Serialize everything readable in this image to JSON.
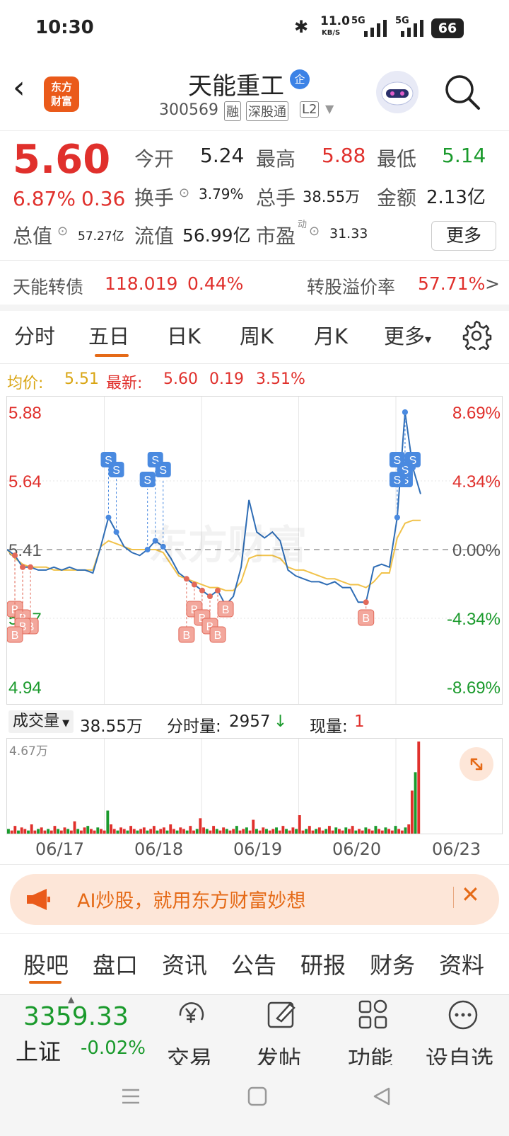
{
  "status": {
    "time": "10:30",
    "speed": "11.0",
    "speed_unit": "KB/S",
    "battery": "66",
    "net1": "5G",
    "net2": "5G"
  },
  "header": {
    "title": "天能重工",
    "code": "300569",
    "tags": [
      "融",
      "深股通",
      "L2"
    ],
    "logo": "东方\n财富",
    "title_badge": "企"
  },
  "quote": {
    "price": "5.60",
    "change_pct": "6.87%",
    "change": "0.36",
    "open_label": "今开",
    "open": "5.24",
    "high_label": "最高",
    "high": "5.88",
    "low_label": "最低",
    "low": "5.14",
    "turnover_label": "换手",
    "turnover": "3.79%",
    "volume_label": "总手",
    "volume": "38.55万",
    "amount_label": "金额",
    "amount": "2.13亿",
    "mcap_label": "总值",
    "mcap": "57.27亿",
    "float_label": "流值",
    "float": "56.99亿",
    "pe_label": "市盈",
    "pe_sup": "动",
    "pe": "31.33",
    "more": "更多"
  },
  "bond": {
    "name": "天能转债",
    "price": "118.019",
    "pct": "0.44%",
    "premium_label": "转股溢价率",
    "premium": "57.71%",
    "arrow": ">"
  },
  "tabs": {
    "items": [
      "分时",
      "五日",
      "日K",
      "周K",
      "月K",
      "更多"
    ],
    "active": "五日",
    "more_arrow": "▾"
  },
  "info": {
    "avg_label": "均价:",
    "avg": "5.51",
    "latest_label": "最新:",
    "latest": "5.60",
    "chg": "0.19",
    "pct": "3.51%"
  },
  "chart_data": {
    "type": "line",
    "title": "",
    "x": [
      "06/17",
      "06/18",
      "06/19",
      "06/20",
      "06/23"
    ],
    "y_left_ticks": [
      "5.88",
      "5.64",
      "5.41",
      "5.17",
      "4.94"
    ],
    "y_right_ticks": [
      "8.69%",
      "4.34%",
      "0.00%",
      "-4.34%",
      "-8.69%"
    ],
    "ylim": [
      4.94,
      5.88
    ],
    "prev_close": 5.41,
    "price": [
      5.41,
      5.39,
      5.35,
      5.35,
      5.34,
      5.34,
      5.35,
      5.34,
      5.35,
      5.34,
      5.34,
      5.33,
      5.42,
      5.52,
      5.47,
      5.42,
      5.4,
      5.39,
      5.41,
      5.44,
      5.42,
      5.38,
      5.33,
      5.31,
      5.29,
      5.27,
      5.25,
      5.27,
      5.22,
      5.25,
      5.35,
      5.58,
      5.47,
      5.45,
      5.47,
      5.44,
      5.34,
      5.32,
      5.31,
      5.3,
      5.3,
      5.29,
      5.3,
      5.28,
      5.28,
      5.23,
      5.23,
      5.35,
      5.36,
      5.35,
      5.52,
      5.88,
      5.69,
      5.6
    ],
    "avg": [
      5.41,
      5.38,
      5.36,
      5.35,
      5.35,
      5.35,
      5.34,
      5.34,
      5.34,
      5.34,
      5.34,
      5.34,
      5.42,
      5.44,
      5.43,
      5.42,
      5.41,
      5.41,
      5.41,
      5.41,
      5.4,
      5.36,
      5.32,
      5.31,
      5.3,
      5.29,
      5.28,
      5.28,
      5.27,
      5.27,
      5.3,
      5.38,
      5.39,
      5.39,
      5.39,
      5.38,
      5.35,
      5.34,
      5.34,
      5.33,
      5.32,
      5.31,
      5.31,
      5.3,
      5.29,
      5.29,
      5.28,
      5.3,
      5.33,
      5.33,
      5.45,
      5.5,
      5.51,
      5.51
    ],
    "markers": {
      "S_count": 10,
      "B_count": 12
    },
    "legend": "none",
    "grid": true
  },
  "volume_bar": {
    "label": "成交量",
    "total": "38.55万",
    "tick_label": "分时量:",
    "tick": "2957",
    "tick_arrow": "↓",
    "cur_label": "现量:",
    "cur": "1",
    "max": "4.67万"
  },
  "volume_data": [
    3,
    2,
    5,
    2,
    4,
    3,
    2,
    6,
    2,
    3,
    4,
    2,
    3,
    2,
    5,
    3,
    2,
    4,
    3,
    2,
    8,
    3,
    2,
    4,
    5,
    3,
    2,
    4,
    3,
    2,
    15,
    6,
    3,
    2,
    4,
    3,
    2,
    5,
    3,
    2,
    3,
    4,
    2,
    3,
    5,
    2,
    3,
    4,
    2,
    6,
    3,
    2,
    4,
    3,
    2,
    5,
    2,
    3,
    10,
    4,
    3,
    2,
    5,
    3,
    2,
    4,
    3,
    2,
    3,
    5,
    2,
    3,
    4,
    2,
    9,
    3,
    2,
    4,
    3,
    2,
    3,
    4,
    2,
    5,
    3,
    2,
    4,
    3,
    12,
    2,
    3,
    5,
    2,
    3,
    4,
    2,
    3,
    5,
    2,
    4,
    3,
    2,
    4,
    3,
    5,
    2,
    3,
    2,
    4,
    3,
    2,
    5,
    3,
    2,
    4,
    3,
    2,
    5,
    3,
    2,
    4,
    6,
    28,
    40,
    60
  ],
  "watermark": "东方财富",
  "banner": {
    "text": "AI炒股，就用东方财富妙想",
    "close": "✕"
  },
  "bottom_tabs": {
    "items": [
      "股吧",
      "盘口",
      "资讯",
      "公告",
      "研报",
      "财务",
      "资料"
    ],
    "active": "股吧"
  },
  "bottombar": {
    "index_value": "3359.33",
    "index_name": "上证",
    "index_pct": "-0.02%",
    "trade": "交易",
    "post": "发帖",
    "func": "功能",
    "watch": "设自选"
  }
}
